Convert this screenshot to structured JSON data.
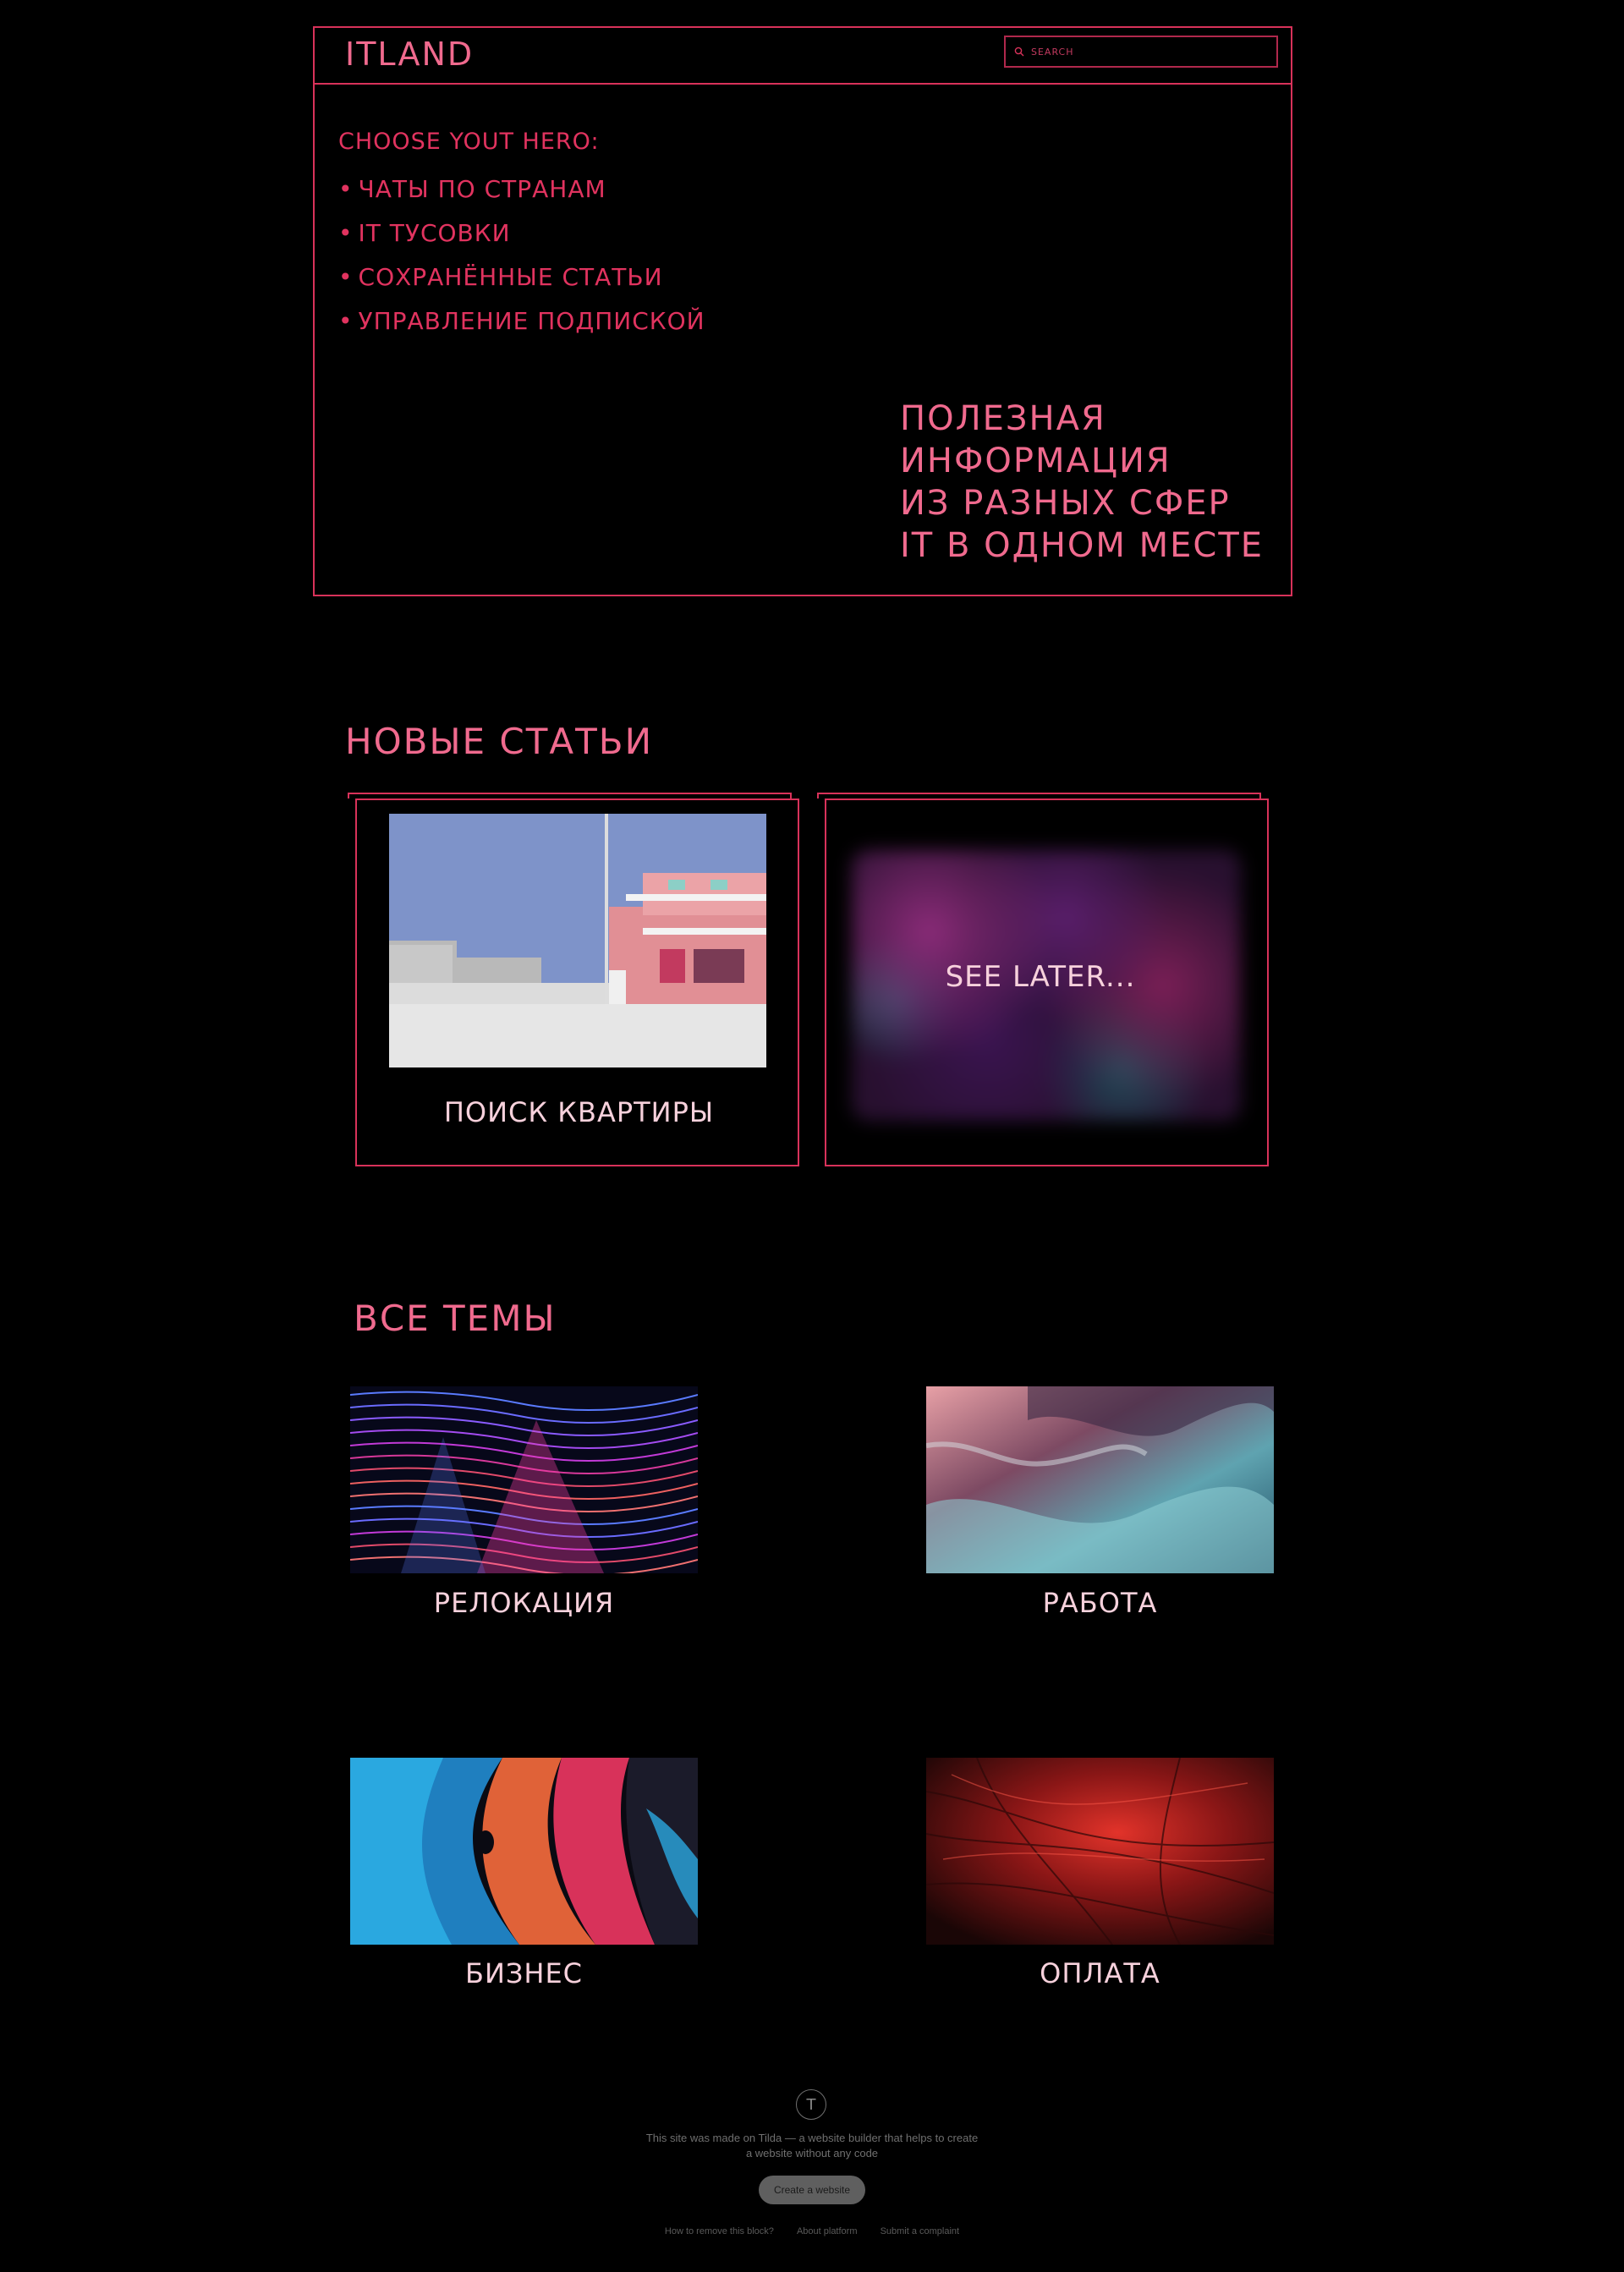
{
  "header": {
    "logo": "ITLAND",
    "search_placeholder": "SEARCH"
  },
  "hero": {
    "menu_title": "CHOOSE YOUT HERO:",
    "menu_items": [
      "ЧАТЫ ПО СТРАНАМ",
      "IT ТУСОВКИ",
      "СОХРАНЁННЫЕ СТАТЬИ",
      "УПРАВЛЕНИЕ ПОДПИСКОЙ"
    ],
    "tagline": [
      "ПОЛЕЗНАЯ",
      "ИНФОРМАЦИЯ",
      "ИЗ РАЗНЫХ СФЕР",
      "IT В ОДНОМ МЕСТЕ"
    ]
  },
  "new_articles": {
    "title": "НОВЫЕ СТАТЬИ",
    "cards": [
      {
        "caption": "ПОИСК КВАРТИРЫ"
      },
      {
        "caption": "SEE LATER..."
      }
    ]
  },
  "topics": {
    "title": "ВСЕ ТЕМЫ",
    "items": [
      {
        "caption": "РЕЛОКАЦИЯ"
      },
      {
        "caption": "РАБОТА"
      },
      {
        "caption": "БИЗНЕС"
      },
      {
        "caption": "ОПЛАТА"
      }
    ]
  },
  "footer": {
    "logo_letter": "T",
    "made_with": "This site was made on Tilda — a website builder that helps to create a website without any code",
    "button": "Create a website",
    "links": [
      "How to remove this block?",
      "About platform",
      "Submit a complaint"
    ]
  },
  "colors": {
    "accent": "#d8325a",
    "accent_text": "#f06a8e",
    "caption": "#f7d1dc",
    "background": "#000000"
  }
}
